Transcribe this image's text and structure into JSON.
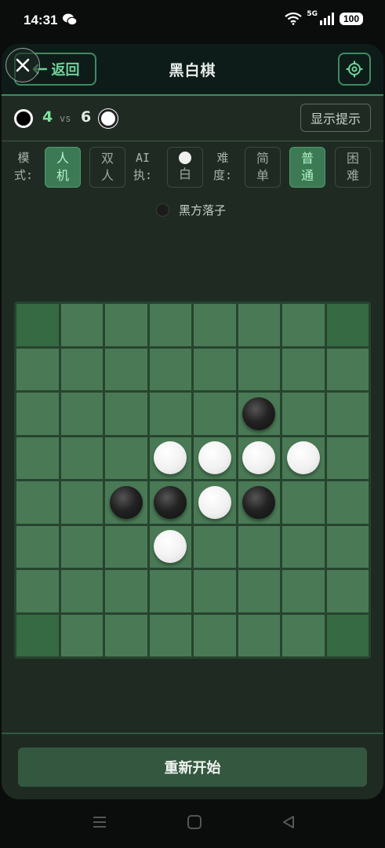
{
  "status_bar": {
    "time": "14:31",
    "network": "5G",
    "battery": "100",
    "icons": [
      "wechat-icon",
      "wifi-icon",
      "signal-icon",
      "battery-icon"
    ]
  },
  "header": {
    "back_label": "返回",
    "title": "黑白棋"
  },
  "score": {
    "black": "4",
    "vs": "vs",
    "white": "6",
    "hint_label": "显示提示"
  },
  "options": {
    "mode_label": [
      "模",
      "式:"
    ],
    "mode_options": [
      {
        "label": [
          "人",
          "机"
        ],
        "active": true
      },
      {
        "label": [
          "双",
          "人"
        ],
        "active": false
      }
    ],
    "ai_label": [
      "AI",
      "执:"
    ],
    "ai_side": "白",
    "difficulty_label": [
      "难",
      "度:"
    ],
    "difficulty_options": [
      {
        "label": [
          "简",
          "单"
        ],
        "active": false
      },
      {
        "label": [
          "普",
          "通"
        ],
        "active": true
      },
      {
        "label": [
          "困",
          "难"
        ],
        "active": false
      }
    ]
  },
  "turn": {
    "text": "黑方落子"
  },
  "board": {
    "size": 8,
    "pieces": [
      {
        "row": 2,
        "col": 5,
        "color": "black"
      },
      {
        "row": 3,
        "col": 3,
        "color": "white"
      },
      {
        "row": 3,
        "col": 4,
        "color": "white"
      },
      {
        "row": 3,
        "col": 5,
        "color": "white"
      },
      {
        "row": 3,
        "col": 6,
        "color": "white"
      },
      {
        "row": 4,
        "col": 2,
        "color": "black"
      },
      {
        "row": 4,
        "col": 3,
        "color": "black"
      },
      {
        "row": 4,
        "col": 4,
        "color": "white"
      },
      {
        "row": 4,
        "col": 5,
        "color": "black"
      },
      {
        "row": 5,
        "col": 3,
        "color": "white"
      }
    ]
  },
  "restart_label": "重新开始",
  "colors": {
    "accent": "#3f8a63",
    "board": "#4a7a55",
    "corner": "#356a43",
    "active_option": "#3c7a55"
  }
}
